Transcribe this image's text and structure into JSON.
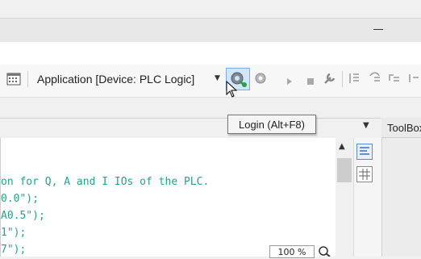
{
  "window": {
    "minimize_label": "–"
  },
  "toolbar": {
    "calendar_icon": "calendar-icon",
    "application_label": "Application [Device: PLC Logic]",
    "dropdown_icon": "chevron-down-icon",
    "login_icon": "login-gear-icon",
    "logout_icon": "logout-gear-icon",
    "run_icon": "play-icon",
    "stop_icon": "stop-icon",
    "reset_icon": "wrench-icon",
    "step_icons": [
      "step-into-icon",
      "step-over-icon",
      "step-out-icon"
    ]
  },
  "tooltip": {
    "text": "Login (Alt+F8)"
  },
  "editor": {
    "code_lines": [
      "on for Q, A and I IOs of the PLC.",
      "0.0\");",
      "A0.5\");",
      "1\");",
      "7\");"
    ],
    "zoom": "100 %"
  },
  "toolbox": {
    "title": "ToolBox"
  },
  "colors": {
    "code_text": "#2a9d8f",
    "tooltip_border": "#767676"
  }
}
